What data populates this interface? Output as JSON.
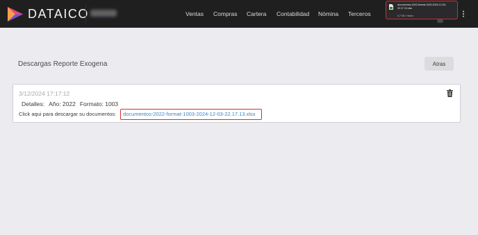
{
  "header": {
    "brand": "DATAICO",
    "company_name_blurred": "",
    "nav": [
      {
        "label": "Ventas"
      },
      {
        "label": "Compras"
      },
      {
        "label": "Cartera"
      },
      {
        "label": "Contabilidad"
      },
      {
        "label": "Nómina"
      },
      {
        "label": "Terceros"
      }
    ],
    "download": {
      "filename": "documentos-2022-format-1003-2024-12-03-22.17.13.xlsx",
      "status": "5,7 KB • Hecho"
    }
  },
  "main": {
    "title": "Descargas Reporte Exogena",
    "back_label": "Atras",
    "report": {
      "date": "3/12/2024 17:17:12",
      "details_label": "Detalles:",
      "year_label": "Año: 2022",
      "format_label": "Formato: 1003",
      "click_text": "Click aqui para descargar su documentos:",
      "file_link": "documentos-2022-format-1003-2024-12-03-22.17.13.xlsx"
    }
  },
  "colors": {
    "navbar": "#1f1f20",
    "background": "#ecebef",
    "link": "#3b82c4",
    "highlight": "#d32f2f"
  },
  "icons": [
    "dataico-logo-icon",
    "file-icon",
    "kebab-menu-icon",
    "trash-icon"
  ]
}
